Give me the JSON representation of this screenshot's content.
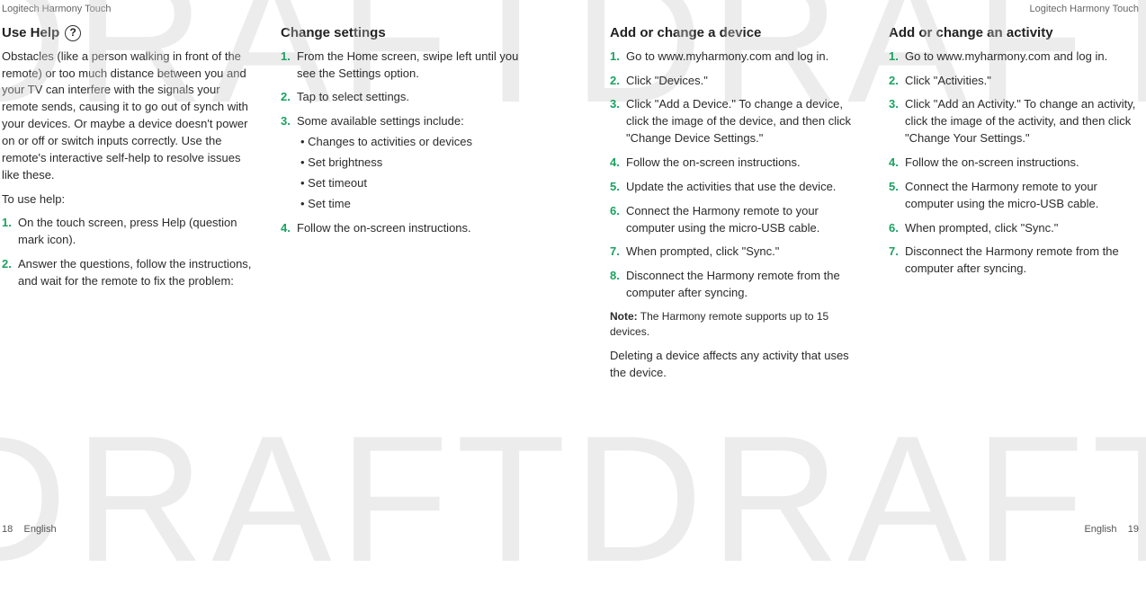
{
  "watermark": "DRAFTDRAFT",
  "header": {
    "left": "Logitech Harmony Touch",
    "right": "Logitech Harmony Touch"
  },
  "footer": {
    "left_num": "18",
    "left_lang": "English",
    "right_lang": "English",
    "right_num": "19"
  },
  "col1": {
    "title": "Use Help",
    "help_q": "?",
    "intro": "Obstacles (like a person walking in front of the remote) or too much distance between you and your TV can interfere with the signals your remote sends, causing it to go out of synch with your devices. Or maybe a device doesn't power on or off or switch inputs correctly. Use the remote's interactive self-help to resolve issues like these.",
    "touse": "To use help:",
    "steps": [
      "On the touch screen, press Help (question mark icon).",
      "Answer the questions, follow the instructions, and wait for the remote to fix the problem:"
    ]
  },
  "col2": {
    "title": "Change settings",
    "steps": [
      "From the Home screen, swipe left until you see the Settings option.",
      "Tap to select settings.",
      "Some available settings include:"
    ],
    "sublist": [
      "Changes to activities or devices",
      "Set brightness",
      "Set timeout",
      "Set time"
    ],
    "step4": "Follow the on-screen instructions."
  },
  "col3": {
    "title": "Add or change a device",
    "steps": [
      "Go to www.myharmony.com and log in.",
      "Click \"Devices.\"",
      "Click \"Add a Device.\" To change a device, click the image of the device, and then click \"Change Device Settings.\"",
      "Follow the on-screen instructions.",
      "Update the activities that use the device.",
      "Connect the Harmony remote to your computer using the micro-USB cable.",
      "When prompted, click \"Sync.\"",
      "Disconnect the Harmony remote from the computer after syncing."
    ],
    "note_label": "Note:",
    "note": " The Harmony remote supports up to 15 devices.",
    "tail": "Deleting a device affects any activity that uses the device."
  },
  "col4": {
    "title": "Add or change an activity",
    "steps": [
      "Go to www.myharmony.com and log in.",
      "Click \"Activities.\"",
      "Click \"Add an Activity.\" To change an activity, click the image of the activity, and then click \"Change Your Settings.\"",
      "Follow the on-screen instructions.",
      "Connect the Harmony remote to your computer using the micro-USB cable.",
      "When prompted, click \"Sync.\"",
      "Disconnect the Harmony remote from the computer after syncing."
    ]
  }
}
